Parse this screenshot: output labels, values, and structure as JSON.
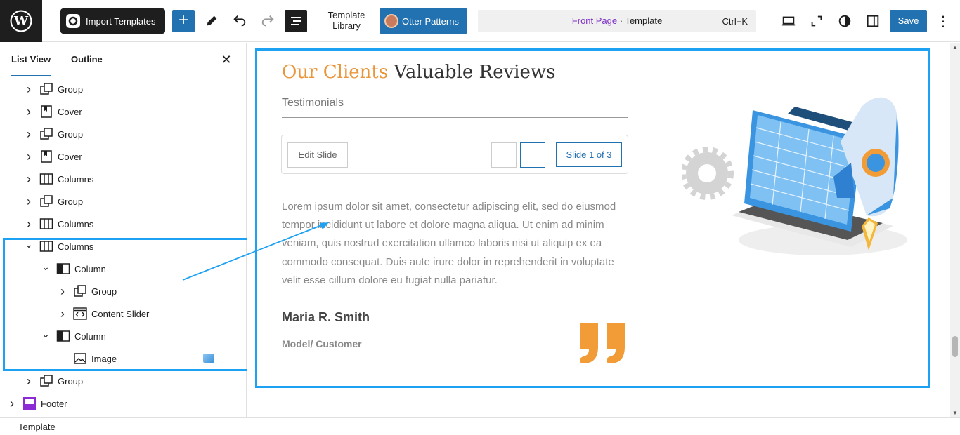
{
  "topbar": {
    "import_label": "Import Templates",
    "template_library_line1": "Template",
    "template_library_line2": "Library",
    "otter_label": "Otter Patterns",
    "command": {
      "page": "Front Page",
      "sep": " · ",
      "type": "Template",
      "shortcut": "Ctrl+K"
    },
    "save_label": "Save"
  },
  "sidebar": {
    "tabs": [
      "List View",
      "Outline"
    ],
    "items": [
      {
        "label": "Group",
        "icon": "group-icon",
        "depth": 1,
        "expanded": false
      },
      {
        "label": "Cover",
        "icon": "cover-icon",
        "depth": 1,
        "expanded": false
      },
      {
        "label": "Group",
        "icon": "group-icon",
        "depth": 1,
        "expanded": false
      },
      {
        "label": "Cover",
        "icon": "cover-icon",
        "depth": 1,
        "expanded": false
      },
      {
        "label": "Columns",
        "icon": "columns-icon",
        "depth": 1,
        "expanded": false
      },
      {
        "label": "Group",
        "icon": "group-icon",
        "depth": 1,
        "expanded": false
      },
      {
        "label": "Columns",
        "icon": "columns-icon",
        "depth": 1,
        "expanded": false
      },
      {
        "label": "Columns",
        "icon": "columns-icon",
        "depth": 1,
        "expanded": true
      },
      {
        "label": "Column",
        "icon": "column-icon",
        "depth": 2,
        "expanded": true
      },
      {
        "label": "Group",
        "icon": "group-icon",
        "depth": 3,
        "expanded": false
      },
      {
        "label": "Content Slider",
        "icon": "content-slider-icon",
        "depth": 3,
        "expanded": false
      },
      {
        "label": "Column",
        "icon": "column-icon",
        "depth": 2,
        "expanded": true
      },
      {
        "label": "Image",
        "icon": "image-icon",
        "depth": 3,
        "expanded": null
      },
      {
        "label": "Group",
        "icon": "group-icon",
        "depth": 1,
        "expanded": false
      },
      {
        "label": "Footer",
        "icon": "footer-icon",
        "depth": 0,
        "expanded": false
      }
    ]
  },
  "canvas": {
    "heading_accent": "Our Clients",
    "heading_rest": " Valuable Reviews",
    "subheading": "Testimonials",
    "edit_slide": "Edit Slide",
    "slide_count": "Slide 1 of 3",
    "quote": "Lorem ipsum dolor sit amet, consectetur adipiscing elit, sed do eiusmod tempor incididunt ut labore et dolore magna aliqua. Ut enim ad minim veniam, quis nostrud exercitation ullamco laboris nisi ut aliquip ex ea commodo consequat. Duis aute irure dolor in reprehenderit in voluptate velit esse cillum dolore eu fugiat nulla pariatur.",
    "author": "Maria R. Smith",
    "role": "Model/ Customer"
  },
  "footer": {
    "breadcrumb": "Template"
  },
  "colors": {
    "accent": "#2271b1",
    "highlight": "#1da1f2",
    "heading_accent": "#e9963a",
    "quote_mark": "#f29c38"
  }
}
